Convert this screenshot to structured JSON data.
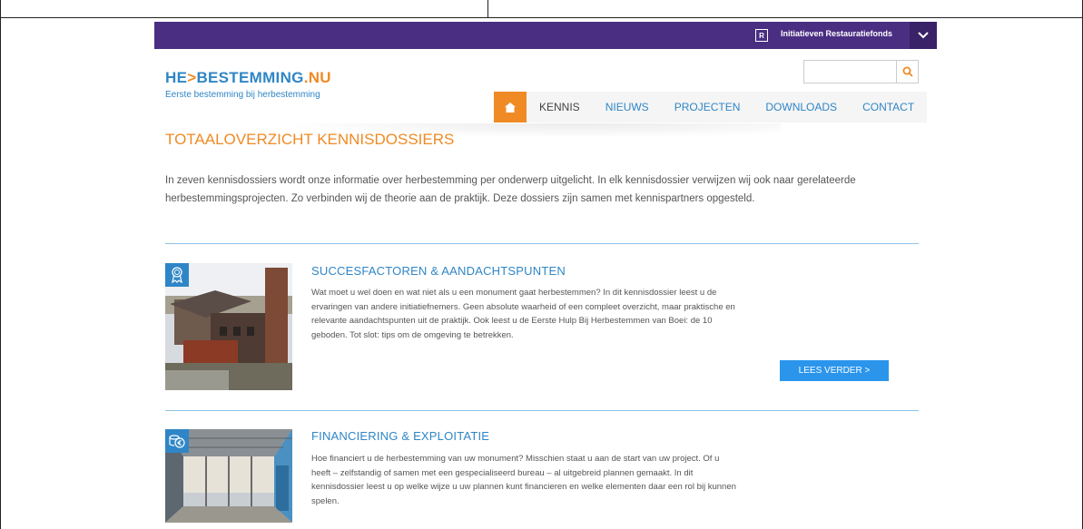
{
  "topbar": {
    "initiative_icon_letter": "R",
    "initiative_label": "Initiatieven Restauratiefonds",
    "chevron_icon": "chevron-down-icon"
  },
  "brand": {
    "logo_prefix": "HE",
    "logo_arrow": ">",
    "logo_main": "BESTEMMING",
    "logo_suffix": ".NU",
    "tagline": "Eerste bestemming bij herbestemming"
  },
  "search": {
    "placeholder": "",
    "icon": "search-icon"
  },
  "nav": {
    "home_icon": "home-icon",
    "items": [
      "KENNIS",
      "NIEUWS",
      "PROJECTEN",
      "DOWNLOADS",
      "CONTACT"
    ]
  },
  "page": {
    "title": "TOTAALOVERZICHT KENNISDOSSIERS",
    "intro": "In zeven kennisdossiers wordt onze informatie over herbestemming per onderwerp uitgelicht. In elk kennisdossier verwijzen wij ook naar gerelateerde herbestemmingsprojecten. Zo verbinden wij de theorie aan de praktijk. Deze dossiers zijn samen met kennispartners opgesteld."
  },
  "dossiers": [
    {
      "title": "SUCCESFACTOREN & AANDACHTSPUNTEN",
      "badge_icon": "award-icon",
      "text": "Wat moet u wel doen en wat niet als u een monument gaat herbestemmen? In dit kennisdossier leest u de ervaringen van andere initiatiefnemers. Geen absolute waarheid of een compleet overzicht, maar praktische en relevante aandachtspunten uit de praktijk. Ook leest u de Eerste Hulp Bij Herbestemmen van Boei: de 10 geboden. Tot slot: tips om de omgeving te betrekken.",
      "button": "LEES VERDER >"
    },
    {
      "title": "FINANCIERING & EXPLOITATIE",
      "badge_icon": "euro-coins-icon",
      "text": "Hoe financiert u de herbestemming van uw monument? Misschien staat u aan de start van uw project. Of u heeft – zelfstandig of samen met een gespecialiseerd bureau – al uitgebreid plannen gemaakt. In dit kennisdossier leest u op welke wijze u uw plannen kunt financieren en welke elementen daar een rol bij kunnen spelen."
    }
  ],
  "colors": {
    "topbar": "#4a2e82",
    "brand_blue": "#2f86c6",
    "accent_orange": "#f08a24",
    "button_blue": "#2b95ec",
    "divider": "#8ec2e6"
  }
}
